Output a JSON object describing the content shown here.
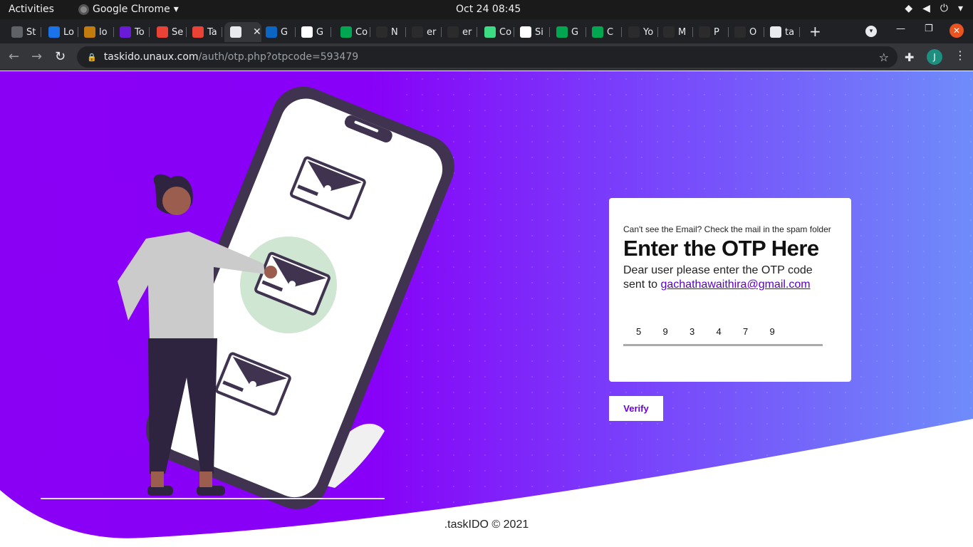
{
  "system_bar": {
    "activities": "Activities",
    "app_name": "Google Chrome",
    "clock": "Oct 24  08:45"
  },
  "tabs": [
    {
      "label": "St",
      "icon": "chrome-icon",
      "color": "#5f6368"
    },
    {
      "label": "Lo",
      "icon": "u-logo-icon",
      "color": "#1a73e8"
    },
    {
      "label": "lo",
      "icon": "pyramid-icon",
      "color": "#c27c0e"
    },
    {
      "label": "To",
      "icon": "bolt-icon",
      "color": "#6a1bd8"
    },
    {
      "label": "Se",
      "icon": "gmail-icon",
      "color": "#ea4335"
    },
    {
      "label": "Ta",
      "icon": "gmail-icon",
      "color": "#ea4335"
    },
    {
      "label": "",
      "icon": "page-icon",
      "color": "#e8eaed",
      "active": true
    },
    {
      "label": "G",
      "icon": "linkedin-icon",
      "color": "#0a66c2"
    },
    {
      "label": "G",
      "icon": "google-icon",
      "color": "#ffffff"
    },
    {
      "label": "Co",
      "icon": "db-icon",
      "color": "#00a650"
    },
    {
      "label": "N",
      "icon": "github-icon",
      "color": "#2b2b2b"
    },
    {
      "label": "er",
      "icon": "github-icon",
      "color": "#2b2b2b"
    },
    {
      "label": "er",
      "icon": "github-icon",
      "color": "#2b2b2b"
    },
    {
      "label": "Co",
      "icon": "android-icon",
      "color": "#3ddc84"
    },
    {
      "label": "Si",
      "icon": "google-icon",
      "color": "#ffffff"
    },
    {
      "label": "G",
      "icon": "db-icon",
      "color": "#00a650"
    },
    {
      "label": "C",
      "icon": "db-icon",
      "color": "#00a650"
    },
    {
      "label": "Yo",
      "icon": "github-icon",
      "color": "#2b2b2b"
    },
    {
      "label": "M",
      "icon": "github-icon",
      "color": "#2b2b2b"
    },
    {
      "label": "P",
      "icon": "github-icon",
      "color": "#2b2b2b"
    },
    {
      "label": "O",
      "icon": "github-icon",
      "color": "#2b2b2b"
    },
    {
      "label": "ta",
      "icon": "page-icon",
      "color": "#e8eaed"
    }
  ],
  "toolbar": {
    "url_host": "taskido.unaux.com",
    "url_path": "/auth/otp.php?otpcode=593479",
    "profile_initial": "J"
  },
  "card": {
    "spam_note": "Can't see the Email? Check the mail in the spam folder",
    "heading": "Enter the OTP Here",
    "desc_text": "Dear user please enter the OTP code sent to ",
    "email": "gachathawaithira@gmail.com",
    "otp_digits": [
      "5",
      "9",
      "3",
      "4",
      "7",
      "9"
    ]
  },
  "verify_label": "Verify",
  "footer": ".taskIDO © 2021",
  "colors": {
    "gradient_start": "#8a00f5",
    "gradient_end": "#6f8cfa",
    "accent": "#6a00d8"
  }
}
